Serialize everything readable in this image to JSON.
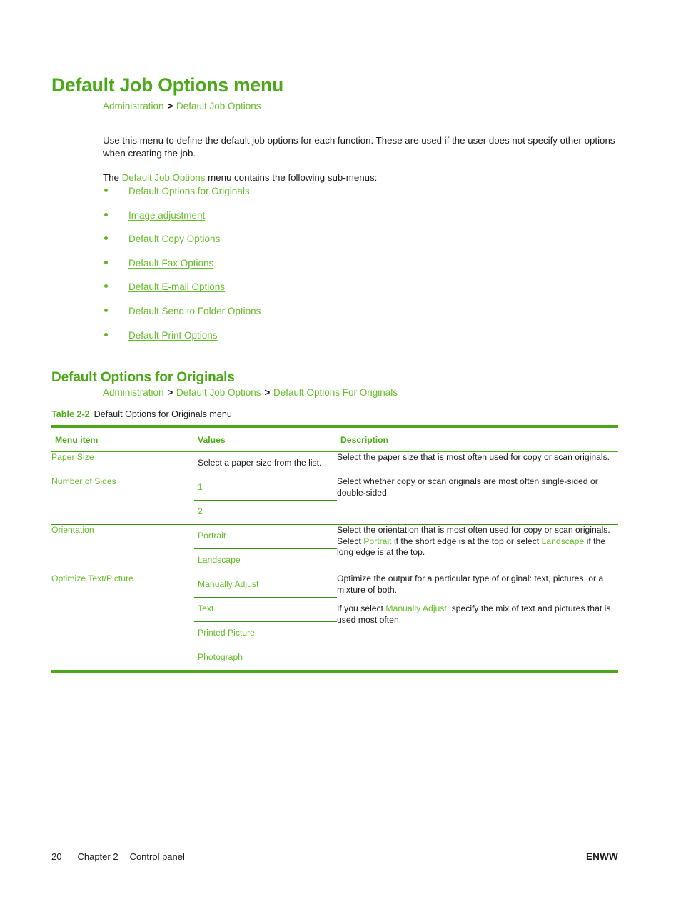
{
  "page": {
    "heading_1": "Default Job Options menu",
    "heading_2": "Default Options for Originals"
  },
  "breadcrumb_1": {
    "part_1": "Administration",
    "sep_1": ">",
    "part_2": "Default Job Options"
  },
  "breadcrumb_2": {
    "part_1": "Administration",
    "sep_1": ">",
    "part_2": "Default Job Options",
    "sep_2": ">",
    "part_3": "Default Options For Originals"
  },
  "paragraphs": {
    "intro": "Use this menu to define the default job options for each function. These are used if the user does not specify other options when creating the job.",
    "submenus_prefix": "The ",
    "submenus_link": "Default Job Options",
    "submenus_suffix": " menu contains the following sub-menus:"
  },
  "submenu_links": [
    {
      "label": "Default Options for Originals"
    },
    {
      "label": "Image adjustment"
    },
    {
      "label": "Default Copy Options"
    },
    {
      "label": "Default Fax Options"
    },
    {
      "label": "Default E-mail Options"
    },
    {
      "label": "Default Send to Folder Options"
    },
    {
      "label": "Default Print Options"
    }
  ],
  "table": {
    "caption_number": "Table 2-2",
    "caption_text": "Default Options for Originals menu",
    "headers": {
      "menu_item": "Menu item",
      "values": "Values",
      "description": "Description"
    },
    "rows": [
      {
        "menu_item": "Paper Size",
        "values": [
          "Select a paper size from the list."
        ],
        "values_are_green": false,
        "description_paragraphs": [
          {
            "segments": [
              {
                "text": "Select the paper size that is most often used for copy or scan originals.",
                "green": false
              }
            ]
          }
        ]
      },
      {
        "menu_item": "Number of Sides",
        "values": [
          "1",
          "2"
        ],
        "values_are_green": true,
        "description_paragraphs": [
          {
            "segments": [
              {
                "text": "Select whether copy or scan originals are most often single-sided or double-sided.",
                "green": false
              }
            ]
          }
        ]
      },
      {
        "menu_item": "Orientation",
        "values": [
          "Portrait",
          "Landscape"
        ],
        "values_are_green": true,
        "description_paragraphs": [
          {
            "segments": [
              {
                "text": "Select the orientation that is most often used for copy or scan originals. Select ",
                "green": false
              },
              {
                "text": "Portrait",
                "green": true
              },
              {
                "text": " if the short edge is at the top or select ",
                "green": false
              },
              {
                "text": "Landscape",
                "green": true
              },
              {
                "text": " if the long edge is at the top.",
                "green": false
              }
            ]
          }
        ]
      },
      {
        "menu_item": "Optimize Text/Picture",
        "values": [
          "Manually Adjust",
          "Text",
          "Printed Picture",
          "Photograph"
        ],
        "values_are_green": true,
        "description_paragraphs": [
          {
            "segments": [
              {
                "text": "Optimize the output for a particular type of original: text, pictures, or a mixture of both.",
                "green": false
              }
            ]
          },
          {
            "segments": [
              {
                "text": "If you select ",
                "green": false
              },
              {
                "text": "Manually Adjust",
                "green": true
              },
              {
                "text": ", specify the mix of text and pictures that is used most often.",
                "green": false
              }
            ]
          }
        ]
      }
    ]
  },
  "footer": {
    "page_number": "20",
    "chapter": "Chapter 2",
    "chapter_title": "Control panel",
    "right_label": "ENWW"
  },
  "colors": {
    "heading_green": "#4CA81A",
    "link_green": "#66BB2A",
    "rule_green": "#3E9113",
    "text_black": "#1a1a1a"
  }
}
